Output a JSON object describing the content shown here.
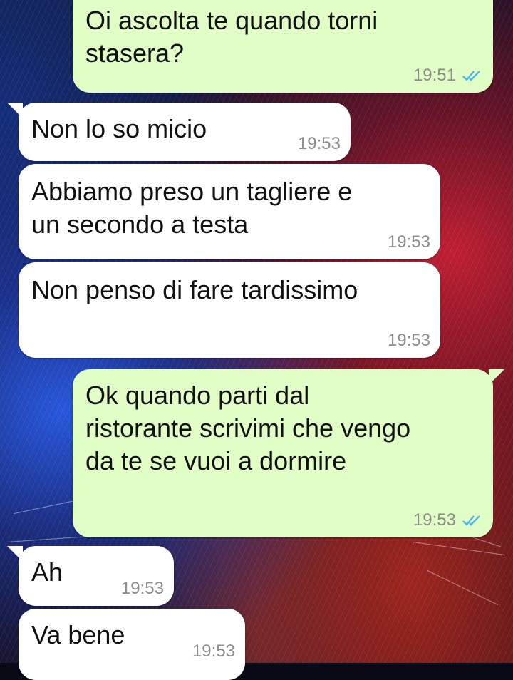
{
  "wallpaper": {
    "description_icon": "lion-icon",
    "colors": {
      "left": "#2a5ae6",
      "right": "#c81e32",
      "base": "#0a0a16"
    }
  },
  "messages": [
    {
      "dir": "out",
      "text": "Oi ascolta te quando torni\nstasera?",
      "time": "19:51",
      "status": "read"
    },
    {
      "dir": "in",
      "text": "Non lo so micio",
      "time": "19:53"
    },
    {
      "dir": "in",
      "text": "Abbiamo preso un tagliere e\nun secondo a testa",
      "time": "19:53"
    },
    {
      "dir": "in",
      "text": "Non penso di fare tardissimo",
      "time": "19:53"
    },
    {
      "dir": "out",
      "text": "Ok quando parti dal\nristorante scrivimi che vengo\nda te se vuoi a dormire",
      "time": "19:53",
      "status": "read"
    },
    {
      "dir": "in",
      "text": "Ah",
      "time": "19:53"
    },
    {
      "dir": "in",
      "text": "Va bene",
      "time": "19:53"
    }
  ],
  "colors": {
    "outgoing_bubble": "#e1fec6",
    "incoming_bubble": "#ffffff",
    "read_ticks": "#4fb6ec",
    "timestamp": "#8a8f8a"
  }
}
